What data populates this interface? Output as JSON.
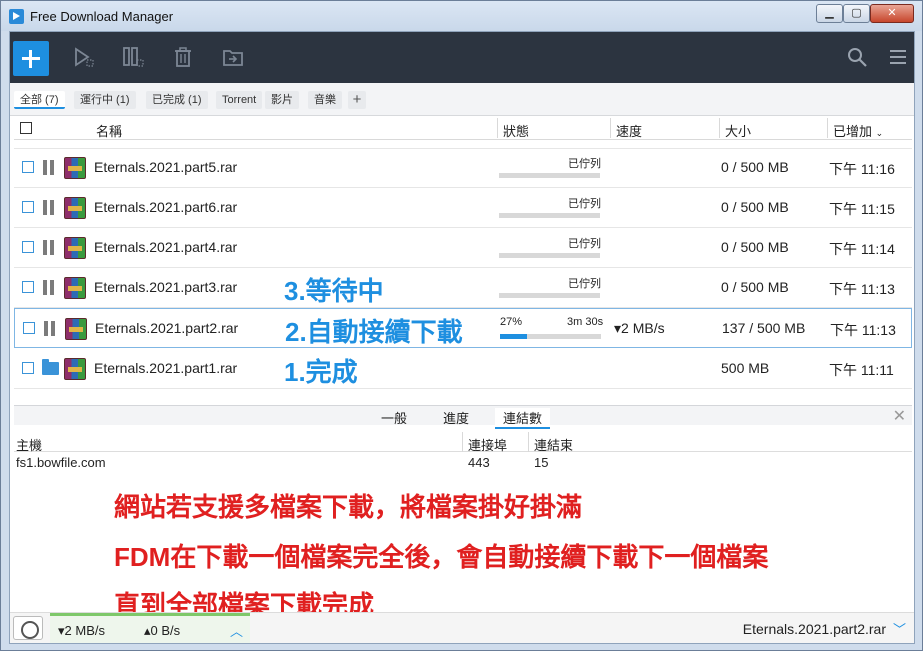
{
  "window": {
    "title": "Free Download Manager"
  },
  "filters": {
    "all": "全部 (7)",
    "running": "運行中 (1)",
    "done": "已完成 (1)",
    "torrent": "Torrent",
    "video": "影片",
    "music": "音樂",
    "add": "+"
  },
  "columns": {
    "name": "名稱",
    "status": "狀態",
    "speed": "速度",
    "size": "大小",
    "added": "已增加"
  },
  "rows": [
    {
      "name": "Eternals.2021.part5.rar",
      "status": "已佇列",
      "progress": 0,
      "size": "0 / 500 MB",
      "added": "下午 11:16"
    },
    {
      "name": "Eternals.2021.part6.rar",
      "status": "已佇列",
      "progress": 0,
      "size": "0 / 500 MB",
      "added": "下午 11:15"
    },
    {
      "name": "Eternals.2021.part4.rar",
      "status": "已佇列",
      "progress": 0,
      "size": "0 / 500 MB",
      "added": "下午 11:14"
    },
    {
      "name": "Eternals.2021.part3.rar",
      "status": "已佇列",
      "progress": 0,
      "size": "0 / 500 MB",
      "added": "下午 11:13",
      "annotation": "3.等待中"
    },
    {
      "name": "Eternals.2021.part2.rar",
      "percent": "27%",
      "eta": "3m 30s",
      "progress": 27,
      "speed": "▾2 MB/s",
      "size": "137 / 500 MB",
      "added": "下午 11:13",
      "annotation": "2.自動接續下載"
    },
    {
      "name": "Eternals.2021.part1.rar",
      "size": "500 MB",
      "added": "下午 11:11",
      "annotation": "1.完成"
    }
  ],
  "detail": {
    "tabs": {
      "general": "一般",
      "progress": "進度",
      "connections": "連結數"
    },
    "close": "✕",
    "headers": {
      "host": "主機",
      "port": "連接埠",
      "ended": "連結束"
    },
    "row": {
      "host": "fs1.bowfile.com",
      "port": "443",
      "ended": "15"
    },
    "messages": [
      "網站若支援多檔案下載，將檔案掛好掛滿",
      "FDM在下載一個檔案完全後，會自動接續下載下一個檔案",
      "直到全部檔案下載完成"
    ]
  },
  "statusbar": {
    "down_speed": "▾2 MB/s",
    "up_speed": "▴0 B/s",
    "current_file": "Eternals.2021.part2.rar"
  },
  "colors": {
    "accent": "#1e8fe0",
    "toolbar": "#2c3440",
    "annotation_blue": "#1e8fe0",
    "annotation_red": "#e02020",
    "speed_green": "#7ec86a"
  }
}
